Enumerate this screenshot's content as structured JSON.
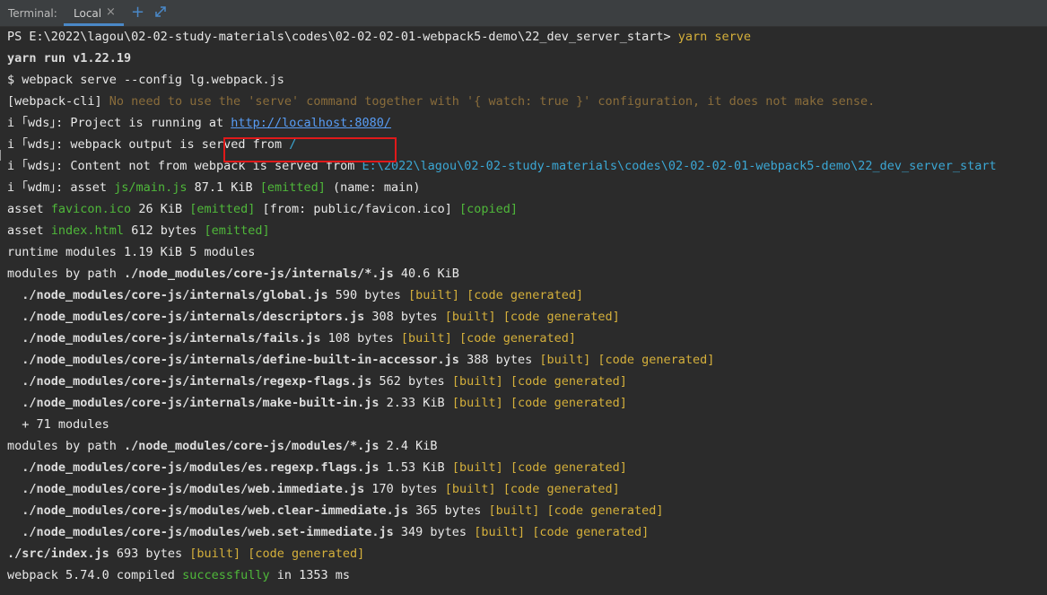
{
  "tabbar": {
    "label": "Terminal:",
    "tab_name": "Local",
    "close_glyph": "×",
    "plus_glyph": "+",
    "icons": {
      "close": "close-icon",
      "add": "plus-icon",
      "expand": "expand-icon"
    }
  },
  "terminal": {
    "prompt_path": "PS E:\\2022\\lagou\\02-02-study-materials\\codes\\02-02-02-01-webpack5-demo\\22_dev_server_start> ",
    "command": "yarn serve",
    "yarn_run": "yarn run v1.22.19",
    "webpack_cmd": "$ webpack serve --config lg.webpack.js",
    "cli_prefix": "[webpack-cli]",
    "cli_warning": " No need to use the 'serve' command together with '{ watch: true }' configuration, it does not make sense.",
    "wds_prefix": "i ｢wds｣",
    "wdm_prefix": "i ｢wdm｣",
    "running_text": ": Project is running at ",
    "running_url": "http://localhost:8080/",
    "output_text": ": webpack output is served from ",
    "output_path": "/",
    "content_text": ": Content not from webpack is served from ",
    "content_path": "E:\\2022\\lagou\\02-02-study-materials\\codes\\02-02-02-01-webpack5-demo\\22_dev_server_start",
    "asset_main_a": ": asset ",
    "asset_main_file": "js/main.js",
    "asset_main_b": " 87.1 KiB ",
    "emitted": "[emitted]",
    "asset_main_c": " (name: main)",
    "asset_label": "asset ",
    "favicon_file": "favicon.ico",
    "favicon_size": " 26 KiB ",
    "favicon_from": " [from: public/favicon.ico] ",
    "copied": "[copied]",
    "index_file": "index.html",
    "index_size": " 612 bytes ",
    "runtime": "runtime modules 1.19 KiB 5 modules",
    "modules_by_path": "modules by path ",
    "internals_path": "./node_modules/core-js/internals/*.js",
    "internals_size": " 40.6 KiB",
    "modules_path": "./node_modules/core-js/modules/*.js",
    "modules_size": " 2.4 KiB",
    "built": "[built]",
    "code_generated": "[code generated]",
    "internals_items": [
      {
        "file": "./node_modules/core-js/internals/global.js",
        "size": " 590 bytes "
      },
      {
        "file": "./node_modules/core-js/internals/descriptors.js",
        "size": " 308 bytes "
      },
      {
        "file": "./node_modules/core-js/internals/fails.js",
        "size": " 108 bytes "
      },
      {
        "file": "./node_modules/core-js/internals/define-built-in-accessor.js",
        "size": " 388 bytes "
      },
      {
        "file": "./node_modules/core-js/internals/regexp-flags.js",
        "size": " 562 bytes "
      },
      {
        "file": "./node_modules/core-js/internals/make-built-in.js",
        "size": " 2.33 KiB "
      }
    ],
    "more_modules": "+ 71 modules",
    "modules_items": [
      {
        "file": "./node_modules/core-js/modules/es.regexp.flags.js",
        "size": " 1.53 KiB "
      },
      {
        "file": "./node_modules/core-js/modules/web.immediate.js",
        "size": " 170 bytes "
      },
      {
        "file": "./node_modules/core-js/modules/web.clear-immediate.js",
        "size": " 365 bytes "
      },
      {
        "file": "./node_modules/core-js/modules/web.set-immediate.js",
        "size": " 349 bytes "
      }
    ],
    "src_file": "./src/index.js",
    "src_size": " 693 bytes ",
    "compiled_a": "webpack 5.74.0 compiled ",
    "compiled_ok": "successfully",
    "compiled_b": " in 1353 ms"
  }
}
